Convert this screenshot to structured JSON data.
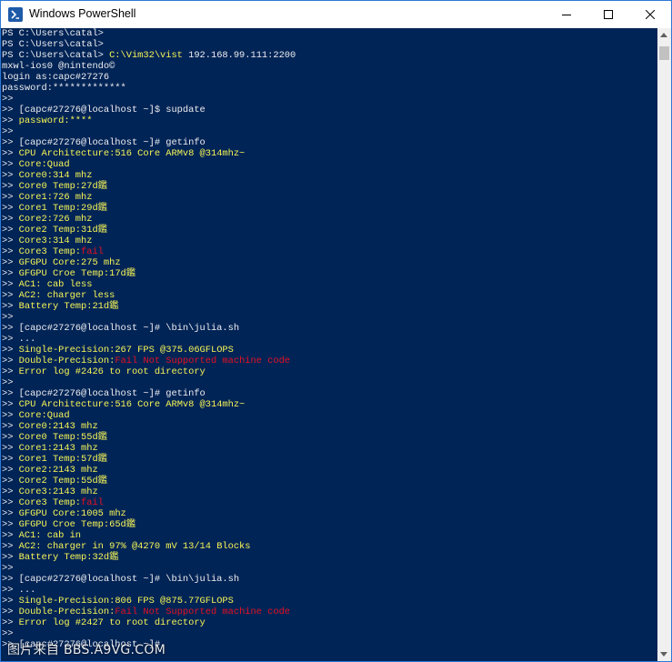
{
  "window": {
    "title": "Windows PowerShell"
  },
  "colors": {
    "background": "#012456",
    "default_text": "#eeedf0",
    "yellow_text": "#f7f556",
    "red_text": "#e81123"
  },
  "console": {
    "lines": [
      [
        {
          "t": "PS C:\\Users\\catal>",
          "c": "w"
        }
      ],
      [
        {
          "t": "PS C:\\Users\\catal>",
          "c": "w"
        }
      ],
      [
        {
          "t": "PS C:\\Users\\catal> ",
          "c": "w"
        },
        {
          "t": "C:\\Vim32\\vist",
          "c": "y"
        },
        {
          "t": " 192.168.99.111:2200",
          "c": "w"
        }
      ],
      [
        {
          "t": "mxwl-ios0 @nintendo©",
          "c": "w"
        }
      ],
      [
        {
          "t": "login as:capc#27276",
          "c": "w"
        }
      ],
      [
        {
          "t": "password:*************",
          "c": "w"
        }
      ],
      [
        {
          "t": ">>",
          "c": "w"
        }
      ],
      [
        {
          "t": ">> [capc#27276@localhost ~]$ supdate",
          "c": "w"
        }
      ],
      [
        {
          "t": ">> ",
          "c": "w"
        },
        {
          "t": "password:****",
          "c": "y"
        }
      ],
      [
        {
          "t": ">>",
          "c": "w"
        }
      ],
      [
        {
          "t": ">> [capc#27276@localhost ~]# getinfo",
          "c": "w"
        }
      ],
      [
        {
          "t": ">> ",
          "c": "w"
        },
        {
          "t": "CPU Architecture:516 Core ARMv8 @314mhz~",
          "c": "y"
        }
      ],
      [
        {
          "t": ">> ",
          "c": "w"
        },
        {
          "t": "Core:Quad",
          "c": "y"
        }
      ],
      [
        {
          "t": ">> ",
          "c": "w"
        },
        {
          "t": "Core0:314 mhz",
          "c": "y"
        }
      ],
      [
        {
          "t": ">> ",
          "c": "w"
        },
        {
          "t": "Core0 Temp:27d鑑",
          "c": "y"
        }
      ],
      [
        {
          "t": ">> ",
          "c": "w"
        },
        {
          "t": "Core1:726 mhz",
          "c": "y"
        }
      ],
      [
        {
          "t": ">> ",
          "c": "w"
        },
        {
          "t": "Core1 Temp:29d鑑",
          "c": "y"
        }
      ],
      [
        {
          "t": ">> ",
          "c": "w"
        },
        {
          "t": "Core2:726 mhz",
          "c": "y"
        }
      ],
      [
        {
          "t": ">> ",
          "c": "w"
        },
        {
          "t": "Core2 Temp:31d鑑",
          "c": "y"
        }
      ],
      [
        {
          "t": ">> ",
          "c": "w"
        },
        {
          "t": "Core3:314 mhz",
          "c": "y"
        }
      ],
      [
        {
          "t": ">> ",
          "c": "w"
        },
        {
          "t": "Core3 Temp:",
          "c": "y"
        },
        {
          "t": "fail",
          "c": "r"
        }
      ],
      [
        {
          "t": ">> ",
          "c": "w"
        },
        {
          "t": "GFGPU Core:275 mhz",
          "c": "y"
        }
      ],
      [
        {
          "t": ">> ",
          "c": "w"
        },
        {
          "t": "GFGPU Croe Temp:17d鑑",
          "c": "y"
        }
      ],
      [
        {
          "t": ">> ",
          "c": "w"
        },
        {
          "t": "AC1: cab less",
          "c": "y"
        }
      ],
      [
        {
          "t": ">> ",
          "c": "w"
        },
        {
          "t": "AC2: charger less",
          "c": "y"
        }
      ],
      [
        {
          "t": ">> ",
          "c": "w"
        },
        {
          "t": "Battery Temp:21d鑑",
          "c": "y"
        }
      ],
      [
        {
          "t": ">>",
          "c": "w"
        }
      ],
      [
        {
          "t": ">> [capc#27276@localhost ~]# \\bin\\julia.sh",
          "c": "w"
        }
      ],
      [
        {
          "t": ">> ...",
          "c": "w"
        }
      ],
      [
        {
          "t": ">> ",
          "c": "w"
        },
        {
          "t": "Single-Precision:267 FPS @375.06GFLOPS",
          "c": "y"
        }
      ],
      [
        {
          "t": ">> ",
          "c": "w"
        },
        {
          "t": "Double-Precision:",
          "c": "y"
        },
        {
          "t": "Fail Not Supported machine code",
          "c": "r"
        }
      ],
      [
        {
          "t": ">> ",
          "c": "w"
        },
        {
          "t": "Error log #2426 to root directory",
          "c": "y"
        }
      ],
      [
        {
          "t": ">>",
          "c": "w"
        }
      ],
      [
        {
          "t": ">> [capc#27276@localhost ~]# getinfo",
          "c": "w"
        }
      ],
      [
        {
          "t": ">> ",
          "c": "w"
        },
        {
          "t": "CPU Architecture:516 Core ARMv8 @314mhz~",
          "c": "y"
        }
      ],
      [
        {
          "t": ">> ",
          "c": "w"
        },
        {
          "t": "Core:Quad",
          "c": "y"
        }
      ],
      [
        {
          "t": ">> ",
          "c": "w"
        },
        {
          "t": "Core0:2143 mhz",
          "c": "y"
        }
      ],
      [
        {
          "t": ">> ",
          "c": "w"
        },
        {
          "t": "Core0 Temp:55d鑑",
          "c": "y"
        }
      ],
      [
        {
          "t": ">> ",
          "c": "w"
        },
        {
          "t": "Core1:2143 mhz",
          "c": "y"
        }
      ],
      [
        {
          "t": ">> ",
          "c": "w"
        },
        {
          "t": "Core1 Temp:57d鑑",
          "c": "y"
        }
      ],
      [
        {
          "t": ">> ",
          "c": "w"
        },
        {
          "t": "Core2:2143 mhz",
          "c": "y"
        }
      ],
      [
        {
          "t": ">> ",
          "c": "w"
        },
        {
          "t": "Core2 Temp:55d鑑",
          "c": "y"
        }
      ],
      [
        {
          "t": ">> ",
          "c": "w"
        },
        {
          "t": "Core3:2143 mhz",
          "c": "y"
        }
      ],
      [
        {
          "t": ">> ",
          "c": "w"
        },
        {
          "t": "Core3 Temp:",
          "c": "y"
        },
        {
          "t": "fail",
          "c": "r"
        }
      ],
      [
        {
          "t": ">> ",
          "c": "w"
        },
        {
          "t": "GFGPU Core:1005 mhz",
          "c": "y"
        }
      ],
      [
        {
          "t": ">> ",
          "c": "w"
        },
        {
          "t": "GFGPU Croe Temp:65d鑑",
          "c": "y"
        }
      ],
      [
        {
          "t": ">> ",
          "c": "w"
        },
        {
          "t": "AC1: cab in",
          "c": "y"
        }
      ],
      [
        {
          "t": ">> ",
          "c": "w"
        },
        {
          "t": "AC2: charger in 97% @4270 mV 13/14 Blocks",
          "c": "y"
        }
      ],
      [
        {
          "t": ">> ",
          "c": "w"
        },
        {
          "t": "Battery Temp:32d鑑",
          "c": "y"
        }
      ],
      [
        {
          "t": ">>",
          "c": "w"
        }
      ],
      [
        {
          "t": ">> [capc#27276@localhost ~]# \\bin\\julia.sh",
          "c": "w"
        }
      ],
      [
        {
          "t": ">> ...",
          "c": "w"
        }
      ],
      [
        {
          "t": ">> ",
          "c": "w"
        },
        {
          "t": "Single-Precision:806 FPS @875.77GFLOPS",
          "c": "y"
        }
      ],
      [
        {
          "t": ">> ",
          "c": "w"
        },
        {
          "t": "Double-Precision:",
          "c": "y"
        },
        {
          "t": "Fail Not Supported machine code",
          "c": "r"
        }
      ],
      [
        {
          "t": ">> ",
          "c": "w"
        },
        {
          "t": "Error log #2427 to root directory",
          "c": "y"
        }
      ],
      [
        {
          "t": ">>",
          "c": "w"
        }
      ],
      [
        {
          "t": ">> [capc#27276@localhost ~]#",
          "c": "w"
        }
      ]
    ]
  },
  "watermark": {
    "text": "图片来自 BBS.A9VG.COM"
  }
}
